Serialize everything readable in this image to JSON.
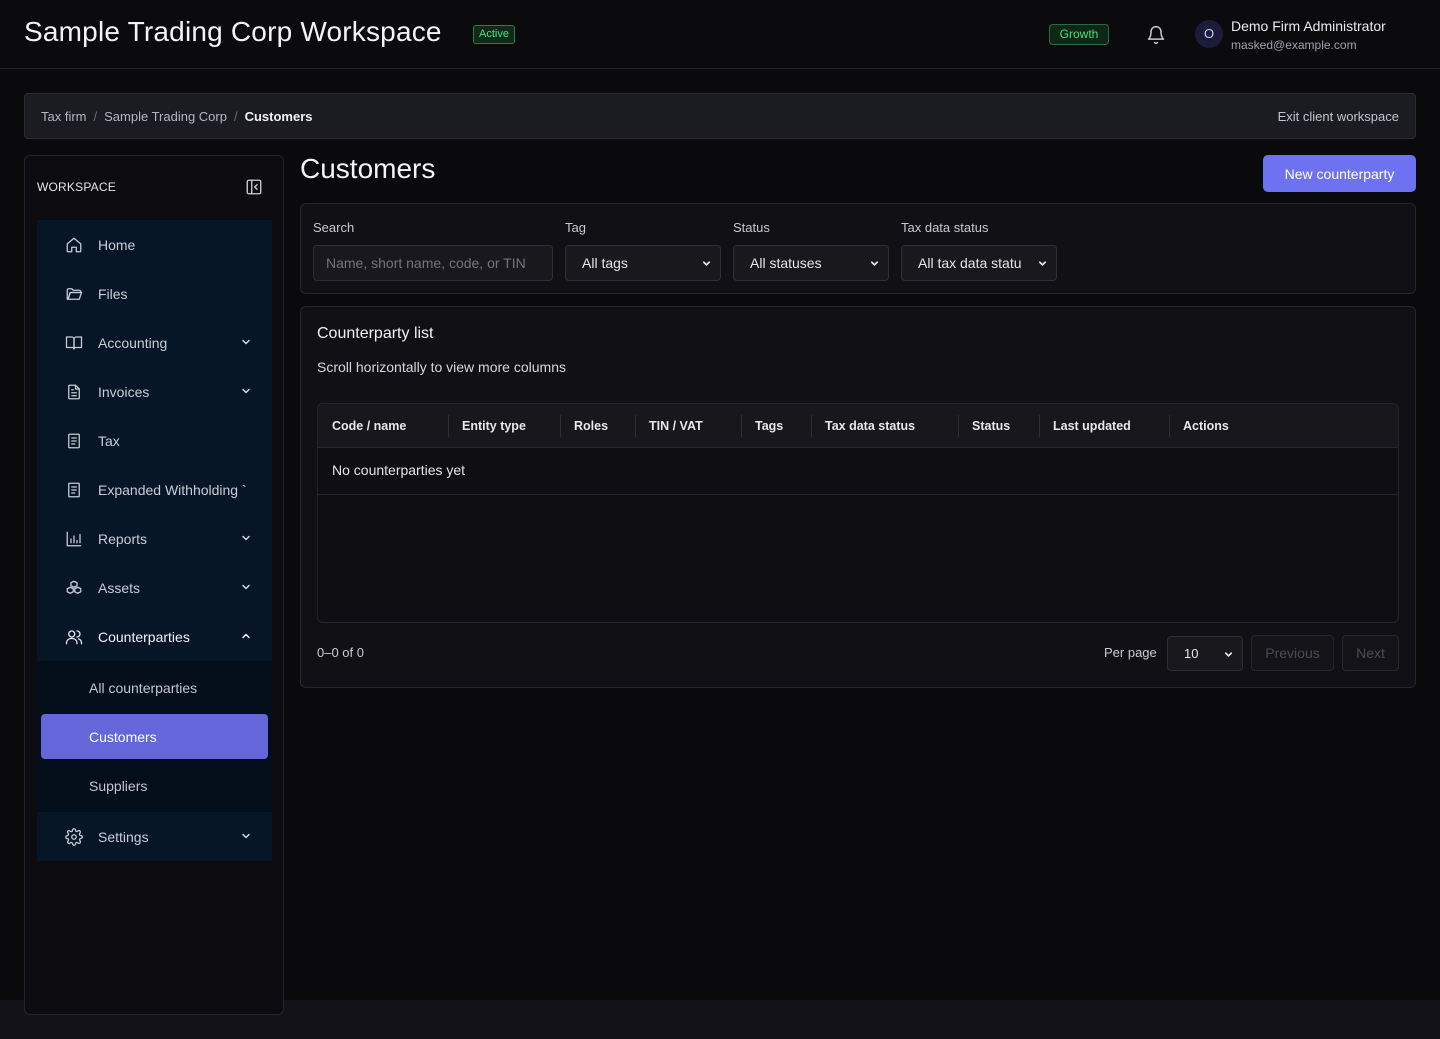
{
  "header": {
    "workspace_title": "Sample Trading Corp Workspace",
    "status_badge": "Active",
    "plan_badge": "Growth",
    "user": {
      "avatar_initial": "O",
      "name": "Demo Firm Administrator",
      "email": "masked@example.com"
    }
  },
  "breadcrumb": {
    "items": [
      "Tax firm",
      "Sample Trading Corp",
      "Customers"
    ],
    "separator": "/",
    "exit_label": "Exit client workspace"
  },
  "sidebar": {
    "heading": "WORKSPACE",
    "items": [
      {
        "label": "Home",
        "icon": "home-icon"
      },
      {
        "label": "Files",
        "icon": "folder-icon"
      },
      {
        "label": "Accounting",
        "icon": "book-icon",
        "expandable": true
      },
      {
        "label": "Invoices",
        "icon": "document-icon",
        "expandable": true
      },
      {
        "label": "Tax",
        "icon": "receipt-icon"
      },
      {
        "label": "Expanded Withholding `",
        "icon": "receipt-icon"
      },
      {
        "label": "Reports",
        "icon": "bar-chart-icon",
        "expandable": true
      },
      {
        "label": "Assets",
        "icon": "boxes-icon",
        "expandable": true
      },
      {
        "label": "Counterparties",
        "icon": "users-icon",
        "expanded": true
      }
    ],
    "counterparties_sub": [
      "All counterparties",
      "Customers",
      "Suppliers"
    ],
    "active_sub": "Customers",
    "settings": {
      "label": "Settings",
      "icon": "gear-icon"
    }
  },
  "main": {
    "title": "Customers",
    "new_button": "New counterparty",
    "filters": {
      "search_label": "Search",
      "search_placeholder": "Name, short name, code, or TIN",
      "tag_label": "Tag",
      "tag_value": "All tags",
      "status_label": "Status",
      "status_value": "All statuses",
      "taxdata_label": "Tax data status",
      "taxdata_value": "All tax data statu"
    },
    "list": {
      "title": "Counterparty list",
      "subtitle": "Scroll horizontally to view more columns",
      "columns": [
        "Code / name",
        "Entity type",
        "Roles",
        "TIN / VAT",
        "Tags",
        "Tax data status",
        "Status",
        "Last updated",
        "Actions"
      ],
      "empty_text": "No counterparties yet",
      "range": "0–0 of 0",
      "per_page_label": "Per page",
      "per_page_value": "10",
      "prev_label": "Previous",
      "next_label": "Next"
    }
  },
  "colors": {
    "accent": "#6e72f0",
    "active_nav": "#6466d9",
    "success": "#4ade80",
    "nav_bg": "#061627"
  }
}
